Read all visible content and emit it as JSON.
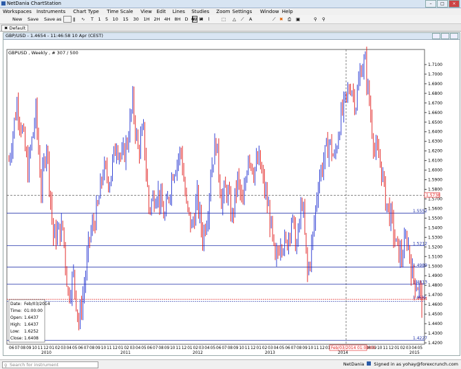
{
  "app": {
    "title": "NetDania ChartStation"
  },
  "menu": [
    "Workspaces",
    "Instruments",
    "Chart Type",
    "Time Scale",
    "View",
    "Edit",
    "Lines",
    "Studies",
    "Zoom",
    "Settings",
    "Window",
    "Help"
  ],
  "toolbar": {
    "new_label": "New",
    "save_label": "Save",
    "save_as_label": "Save as",
    "timeframes": [
      "T",
      "1",
      "5",
      "10",
      "15",
      "30",
      "1H",
      "2H",
      "4H",
      "8H",
      "D",
      "W",
      "M"
    ]
  },
  "tab": {
    "label": "Default"
  },
  "chart_window": {
    "title": "GBP/USD - 1.4654 - 11:46:58 10 Apr (CEST)"
  },
  "chart_data": {
    "type": "candlestick",
    "instrument_label": "GBPUSD , Weekly , # 307 / 500",
    "ylim": [
      1.42,
      1.72
    ],
    "y_ticks": [
      "1.7100",
      "1.7000",
      "1.6900",
      "1.6800",
      "1.6700",
      "1.6600",
      "1.6500",
      "1.6400",
      "1.6300",
      "1.6200",
      "1.6100",
      "1.6000",
      "1.5900",
      "1.5800",
      "1.5700",
      "1.5600",
      "1.5500",
      "1.5400",
      "1.5300",
      "1.5200",
      "1.5100",
      "1.5000",
      "1.4900",
      "1.4800",
      "1.4700",
      "1.4600",
      "1.4500",
      "1.4400",
      "1.4300",
      "1.4200"
    ],
    "x_month_labels": "06 07 08 09 10 11 12 01 02 03 04 05 06 07 08 09 10 11 12 01 02 03 04 05 06 07 08 09 10 11 12 01 02 03 04 05 06 07 08 09 10 11 12 01 02 03 04 05 06 07 08 09 10 11 12 01 02 03 04 05 06 07 08 09 10 11 12 01 02 03 04 05",
    "x_year_labels": [
      "2010",
      "2011",
      "2012",
      "2013",
      "2014",
      "2015"
    ],
    "horizontal_levels": [
      {
        "value": 1.5552,
        "label": "1.5552",
        "color": "#2233aa"
      },
      {
        "value": 1.5212,
        "label": "1.5212",
        "color": "#2233aa"
      },
      {
        "value": 1.4989,
        "label": "1.4989",
        "color": "#2233aa"
      },
      {
        "value": 1.4813,
        "label": "1.4813",
        "color": "#2233aa"
      },
      {
        "value": 1.4227,
        "label": "1.4227",
        "color": "#2233aa"
      }
    ],
    "crosshair": {
      "price": 1.5738,
      "price_label": "1.5738",
      "date_label": "Feb/03/2014 01:00:00"
    },
    "current_price": {
      "value": 1.4654,
      "label": "1.4654"
    },
    "other_price_label": "1.4636",
    "info_box": {
      "Date": "Feb/03/2014",
      "Time": "01:00:00",
      "Open": "1.6437",
      "High": "1.6437",
      "Low": "1.6252",
      "Close": "1.6408"
    },
    "colors": {
      "up": "#1f2fd0",
      "down": "#e01818"
    }
  },
  "status": {
    "search_placeholder": "Search for instrument",
    "brand": "NetDania",
    "signed_in": "Signed in as yohay@forexcrunch.com"
  }
}
